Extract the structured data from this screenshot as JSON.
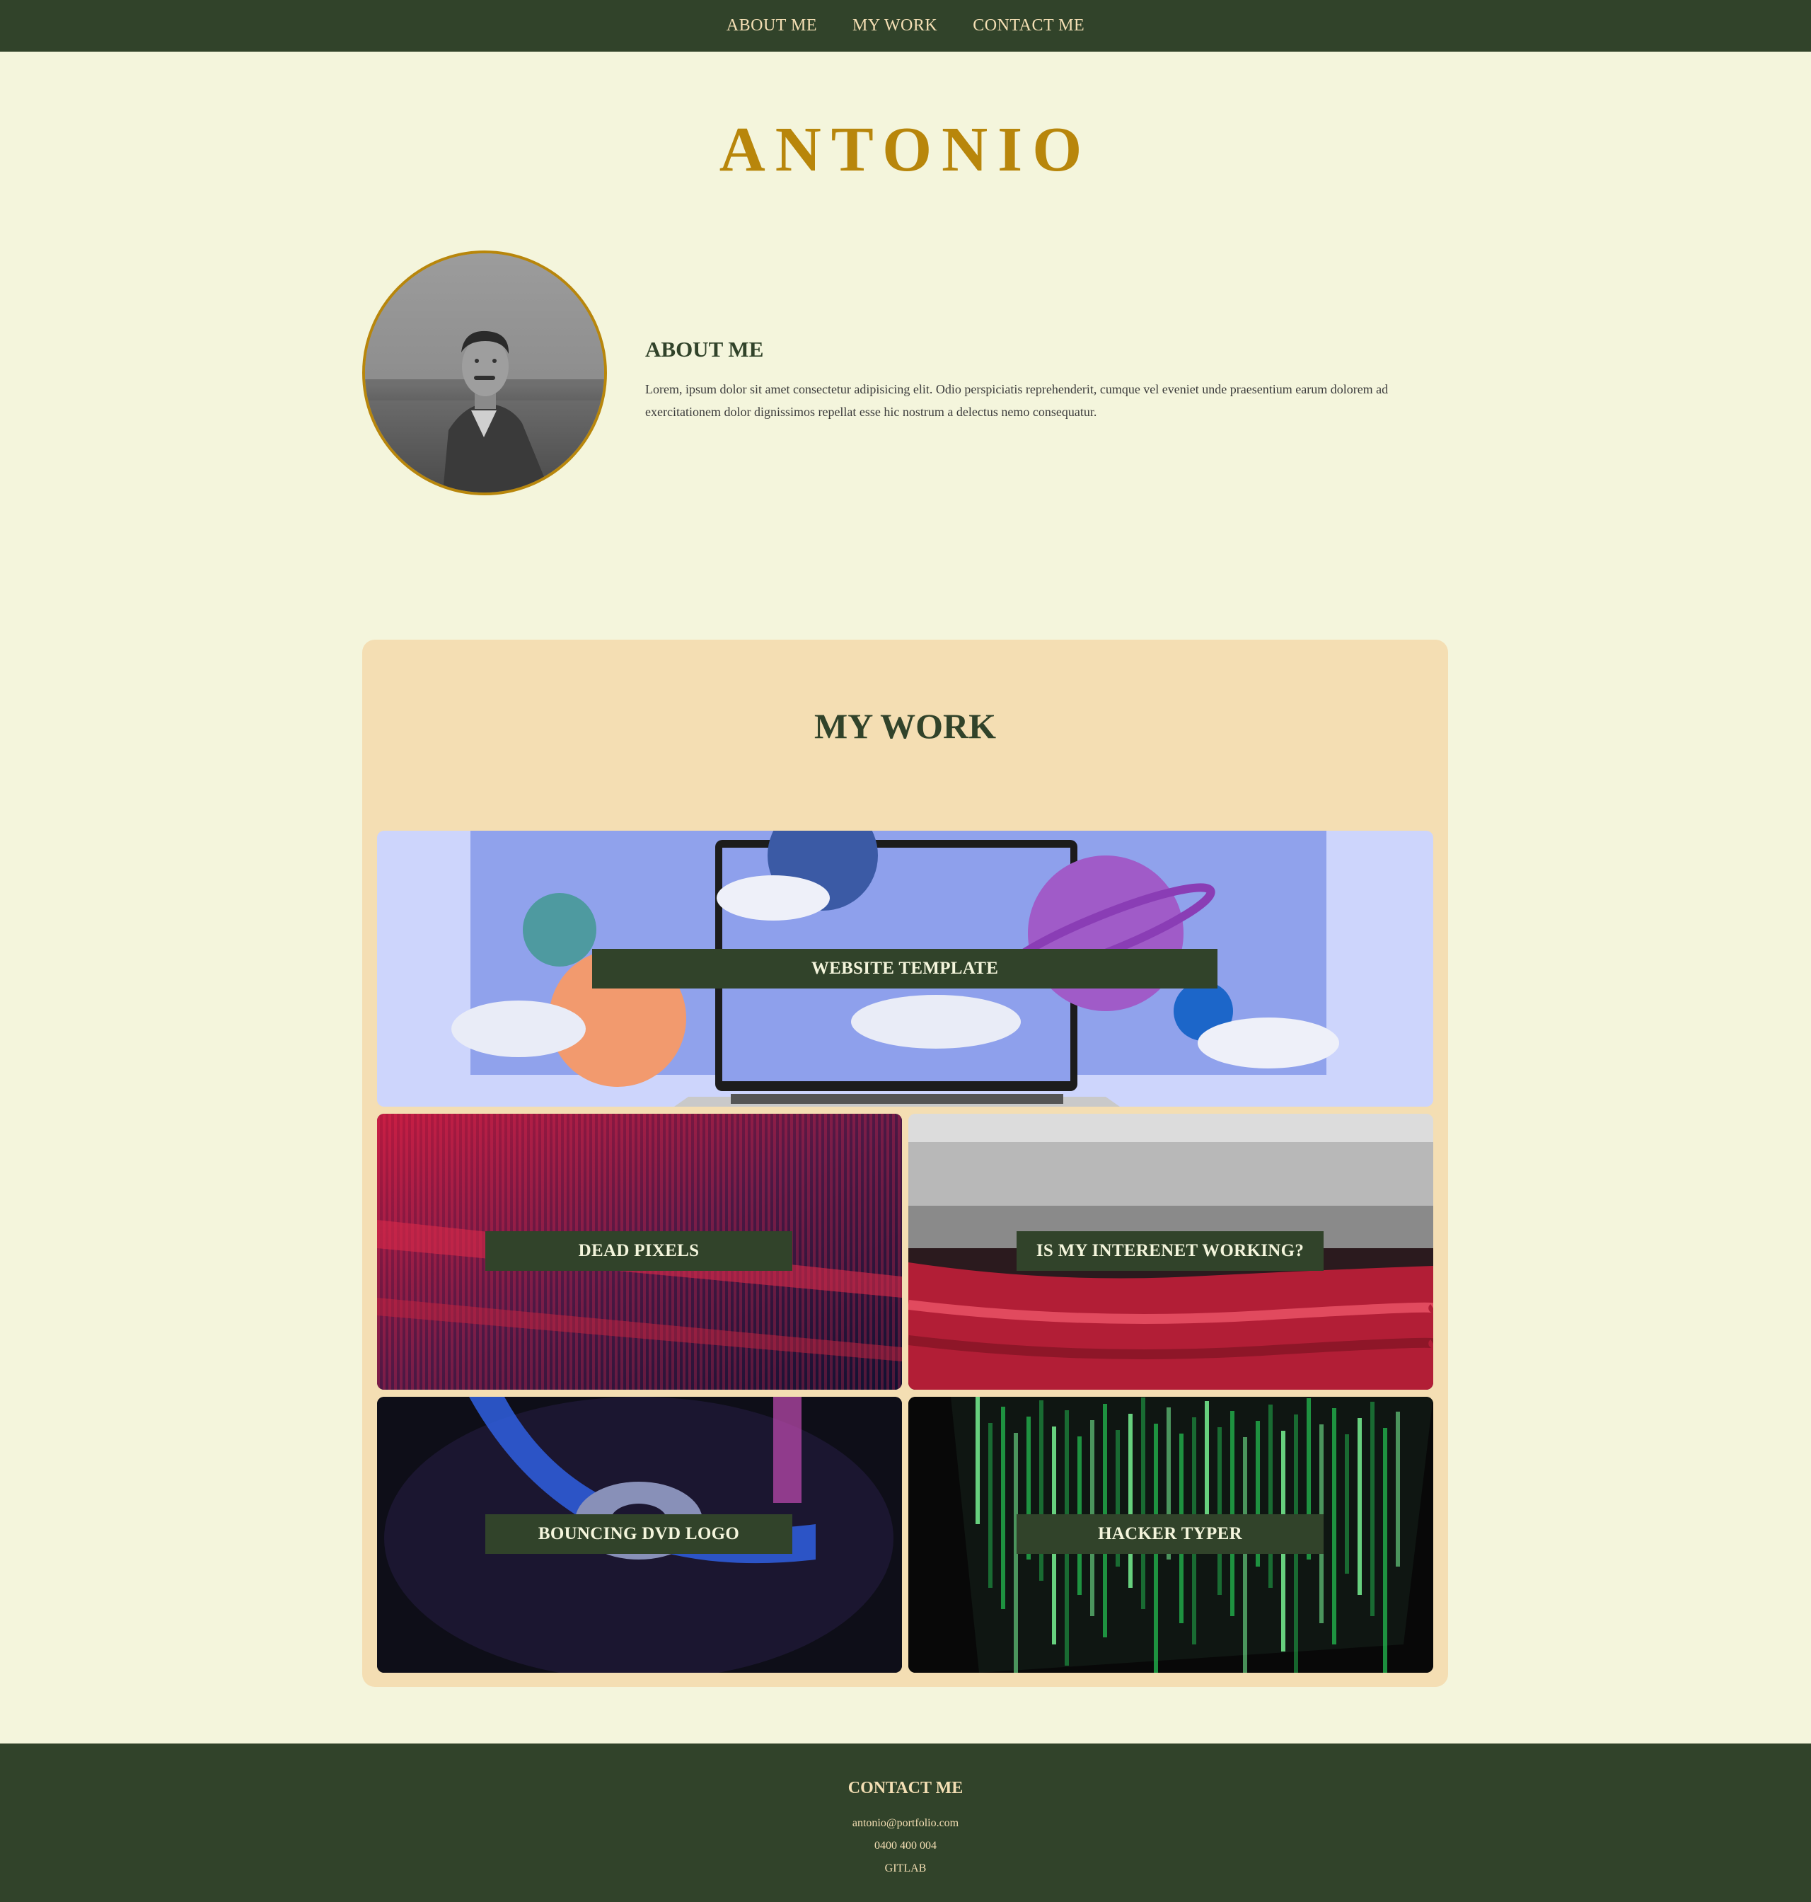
{
  "nav": {
    "items": [
      "ABOUT ME",
      "MY WORK",
      "CONTACT ME"
    ]
  },
  "site_title": "ANTONIO",
  "about": {
    "heading": "ABOUT ME",
    "text": "Lorem, ipsum dolor sit amet consectetur adipisicing elit. Odio perspiciatis reprehenderit, cumque vel eveniet unde praesentium earum dolorem ad exercitationem dolor dignissimos repellat esse hic nostrum a delectus nemo consequatur."
  },
  "work": {
    "heading": "MY WORK",
    "projects": [
      {
        "label": "WEBSITE TEMPLATE"
      },
      {
        "label": "DEAD PIXELS"
      },
      {
        "label": "IS MY INTERENET WORKING?"
      },
      {
        "label": "BOUNCING DVD LOGO"
      },
      {
        "label": "HACKER TYPER"
      }
    ]
  },
  "footer": {
    "heading": "CONTACT ME",
    "email": "antonio@portfolio.com",
    "phone": "0400 400 004",
    "gitlab": "GITLAB"
  },
  "colors": {
    "background": "#f4f5dc",
    "nav_bg": "#31432a",
    "accent_gold": "#b8860b",
    "card_panel": "#f4deb3",
    "label_bg": "#31432a"
  }
}
